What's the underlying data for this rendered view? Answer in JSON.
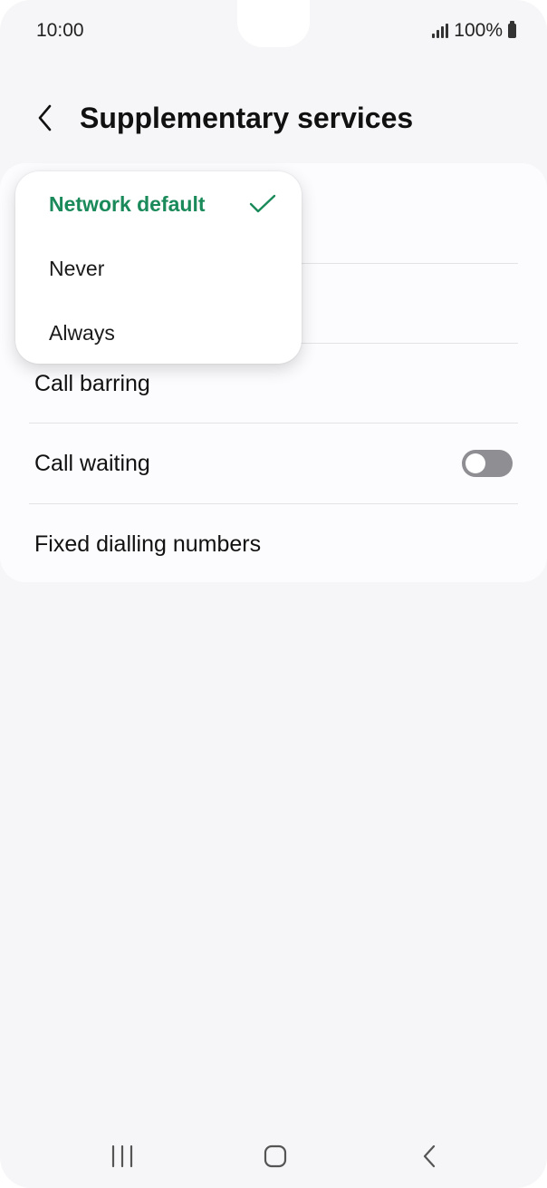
{
  "status_bar": {
    "time": "10:00",
    "battery": "100%"
  },
  "header": {
    "title": "Supplementary services",
    "back_icon": "chevron-left-icon"
  },
  "settings": {
    "rows": [
      {
        "label": "Call barring"
      },
      {
        "label": "Call waiting",
        "toggle": false
      },
      {
        "label": "Fixed dialling numbers"
      }
    ]
  },
  "popup": {
    "options": [
      {
        "label": "Network default",
        "selected": true
      },
      {
        "label": "Never",
        "selected": false
      },
      {
        "label": "Always",
        "selected": false
      }
    ],
    "check_icon": "checkmark-icon"
  },
  "nav_bar": {
    "recents_icon": "recents-icon",
    "home_icon": "home-icon",
    "back_icon": "back-icon"
  },
  "colors": {
    "accent_green": "#1a8a5a",
    "background": "#f6f6f8",
    "card": "#fcfcfe",
    "toggle_off": "#8e8e93"
  }
}
